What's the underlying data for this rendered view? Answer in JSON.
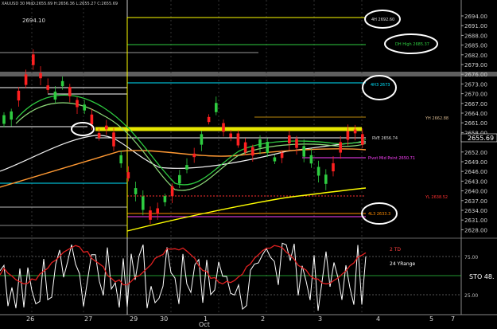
{
  "window": {
    "title": "XAUUSD 30 Min",
    "ohlc_line": "O:2655.69  H:2656.36  L:2655.27  C:2655.69",
    "price_marker": "2694.10"
  },
  "price_axis": {
    "ticks": [
      "2694.00",
      "2691.00",
      "2688.00",
      "2685.00",
      "2682.00",
      "2679.00",
      "2676.00",
      "2673.00",
      "2670.00",
      "2667.00",
      "2664.00",
      "2661.00",
      "2658.00",
      "2655.69",
      "2652.00",
      "2649.00",
      "2646.00",
      "2643.00",
      "2640.00",
      "2637.00",
      "2634.00",
      "2631.00",
      "2628.00"
    ],
    "current": "2655.69"
  },
  "stoch_axis": {
    "ticks": [
      "75.00",
      "25.00"
    ],
    "label": "STO 48."
  },
  "time_axis": {
    "labels": [
      "26",
      "27",
      "29",
      "30",
      "1",
      "2",
      "3",
      "4",
      "5",
      "7"
    ],
    "month": "Oct"
  },
  "annotations": {
    "level_4h": "4H 2692.60",
    "level_dh": "DH High 2685.37",
    "level_4h_mid": "4H3 2673",
    "level_yh": "YH 2662.88",
    "level_rve": "RVE 2656.74",
    "level_pivot": "Pivot Mid Point 2650.71",
    "level_yl": "YL 2638.52",
    "level_4l": "4L3 2633.3",
    "td": "2 TD",
    "yrange": "24 YRange"
  },
  "colors": {
    "bg": "#000000",
    "up": "#2ecc40",
    "down": "#ff2020",
    "yellow": "#ffff00",
    "cyan": "#00e5ff",
    "stoch": "#ffffff",
    "stoch_signal": "#e02020"
  }
}
